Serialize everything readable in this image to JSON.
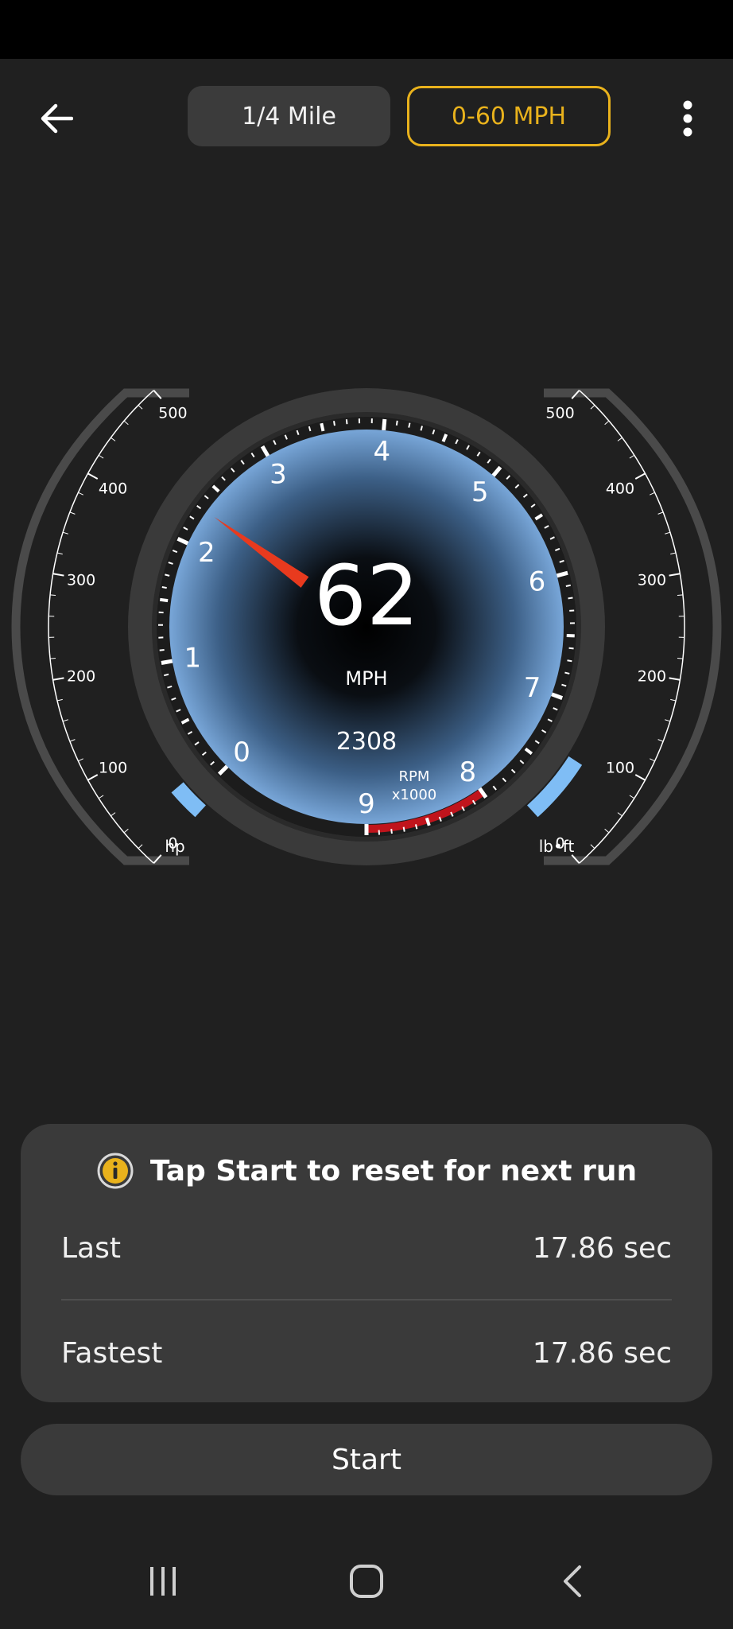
{
  "tabs": {
    "quarter_mile": "1/4 Mile",
    "zero_sixty": "0-60 MPH"
  },
  "gauge": {
    "speed_value": "62",
    "speed_unit": "MPH",
    "rpm_value": "2308",
    "rpm_unit_line1": "RPM",
    "rpm_unit_line2": "x1000",
    "rpm_needle_thousands": 2.308,
    "rpm_max": 9,
    "redline_from": 8,
    "rpm_ticks": [
      "0",
      "1",
      "2",
      "3",
      "4",
      "5",
      "6",
      "7",
      "8",
      "9"
    ],
    "hp_ticks": [
      "0",
      "100",
      "200",
      "300",
      "400",
      "500"
    ],
    "hp_unit": "hp",
    "torque_ticks": [
      "0",
      "100",
      "200",
      "300",
      "400",
      "500"
    ],
    "torque_unit": "lb•ft",
    "hp_level_fraction": 0.08,
    "torque_level_fraction": 0.16,
    "colors": {
      "accent": "#e9b21c",
      "needle": "#e83a1e",
      "redline": "#c0141c",
      "level": "#7fbdf5"
    }
  },
  "info": {
    "icon": "info-circle-icon",
    "message": "Tap Start to reset for next run",
    "last_label": "Last",
    "last_value": "17.86 sec",
    "fastest_label": "Fastest",
    "fastest_value": "17.86 sec"
  },
  "start_label": "Start",
  "nav": {
    "recents_icon": "recents-icon",
    "home_icon": "home-icon",
    "back_icon": "nav-back-icon"
  }
}
